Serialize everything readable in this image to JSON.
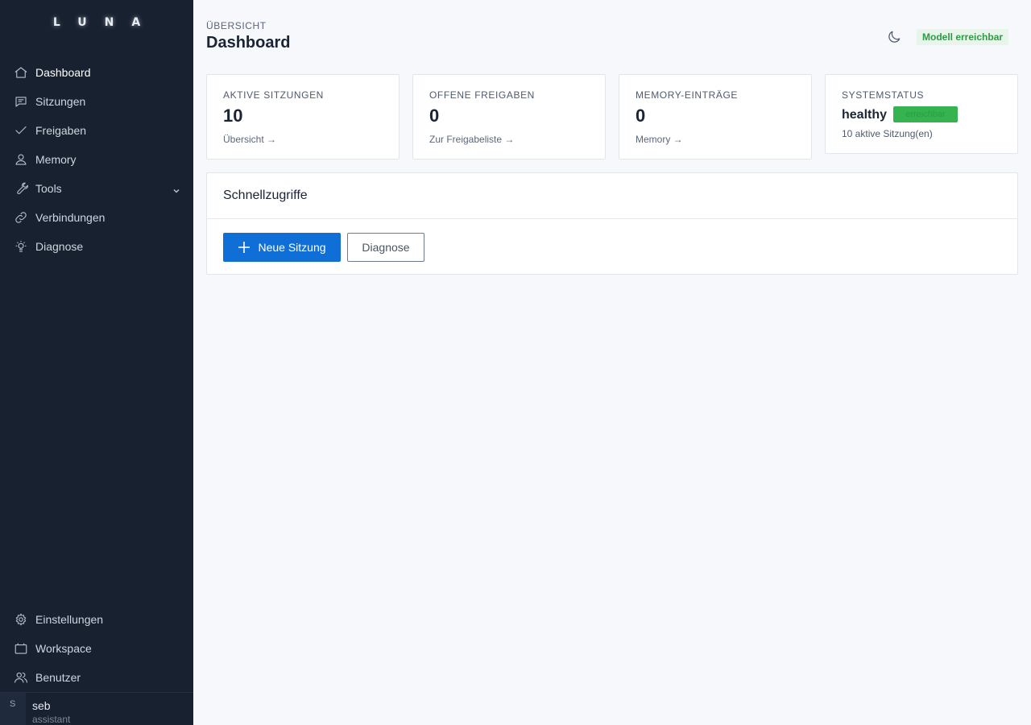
{
  "sidebar": {
    "logo": "LUNA",
    "items": [
      {
        "label": "Dashboard",
        "icon": "home-icon"
      },
      {
        "label": "Sitzungen",
        "icon": "chat-icon"
      },
      {
        "label": "Freigaben",
        "icon": "check-icon"
      },
      {
        "label": "Memory",
        "icon": "user-icon"
      },
      {
        "label": "Tools",
        "icon": "wrench-icon"
      },
      {
        "label": "Verbindungen",
        "icon": "link-icon"
      },
      {
        "label": "Diagnose",
        "icon": "bulb-icon"
      }
    ],
    "bottom_items": [
      {
        "label": "Einstellungen",
        "icon": "gear-icon"
      },
      {
        "label": "Workspace",
        "icon": "folder-icon"
      },
      {
        "label": "Benutzer",
        "icon": "users-icon"
      }
    ],
    "user": {
      "initial": "S",
      "name": "seb",
      "role": "assistant"
    }
  },
  "header": {
    "eyebrow": "ÜBERSICHT",
    "title": "Dashboard",
    "model_status": "Modell erreichbar",
    "model_status_color": "#2f9a45"
  },
  "cards": [
    {
      "label": "AKTIVE SITZUNGEN",
      "value": "10",
      "link": "Übersicht →"
    },
    {
      "label": "OFFENE FREIGABEN",
      "value": "0",
      "link": "Zur Freigabeliste →"
    },
    {
      "label": "MEMORY-EINTRÄGE",
      "value": "0",
      "link": "Memory →"
    },
    {
      "label": "SYSTEMSTATUS",
      "status": "healthy",
      "chip": "erreichbar",
      "sub": "10 aktive Sitzung(en)",
      "chip_color": "#34b350"
    }
  ],
  "quick": {
    "title": "Schnellzugriffe",
    "primary_label": "Neue Sitzung",
    "secondary_label": "Diagnose"
  },
  "colors": {
    "sidebar_bg": "#172130",
    "accent": "#0f6fd6",
    "page_bg": "#f6f8fb"
  }
}
